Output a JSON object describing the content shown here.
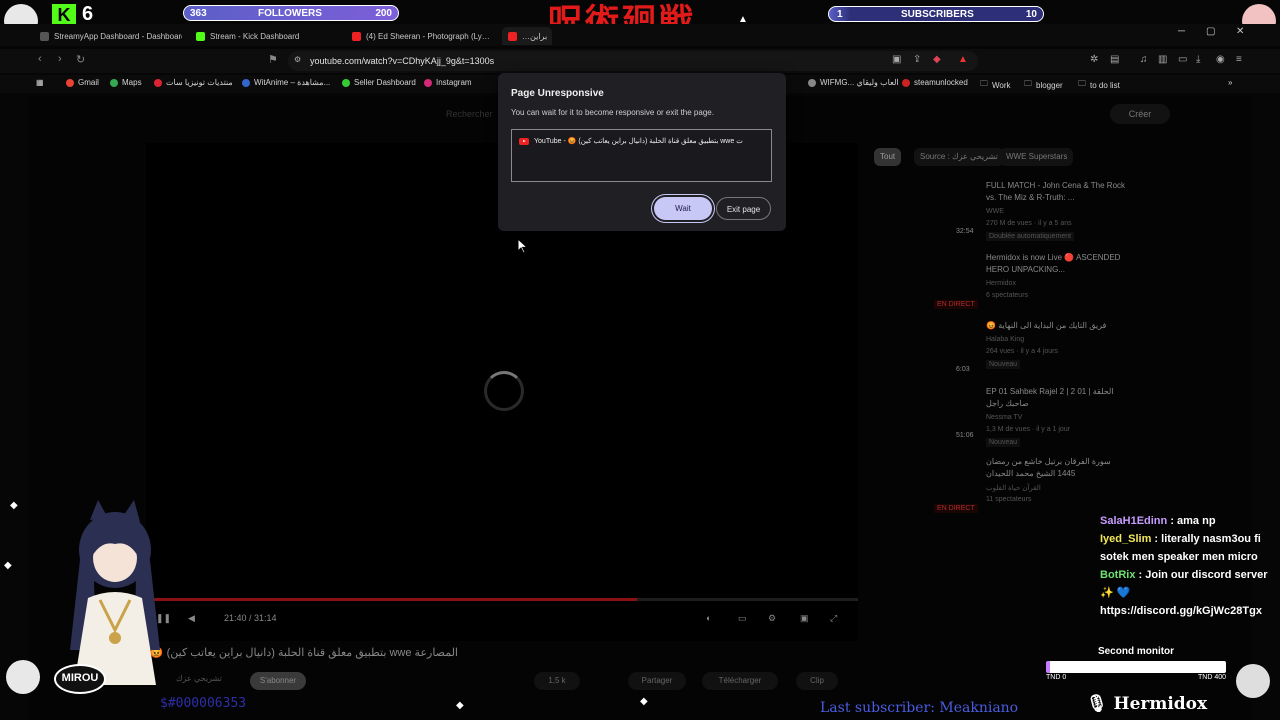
{
  "overlay": {
    "kick_count": "6",
    "kick_logo": "K",
    "followers": {
      "current": "363",
      "label": "FOLLOWERS",
      "goal": "200",
      "progress": 1.0
    },
    "subscribers": {
      "current": "1",
      "label": "SUBSCRIBERS",
      "goal": "10",
      "progress": 0.1
    },
    "jp_title": "呪術廻戦",
    "chat": [
      {
        "name": "SalaH1Edinn",
        "text": ": ama np",
        "color": "purple"
      },
      {
        "name": "Iyed_Slim",
        "text": ": literally nasm3ou fi sotek men speaker men micro",
        "color": "yellow"
      },
      {
        "name": "BotRix",
        "text": ": Join our discord server ✨ 💙 https://discord.gg/kGjWc28Tgx",
        "color": "green"
      }
    ],
    "second_monitor": {
      "label": "Second monitor",
      "min": "TND 0",
      "max": "TND 400",
      "progress": 0.02
    },
    "brand": "🎙 Hermidox",
    "last_subscriber": "Last subscriber: Meakniano",
    "ticker": "$#000006353",
    "mirou_badge": "MIROU"
  },
  "browser": {
    "tabs": [
      {
        "label": "StreamyApp Dashboard - Dashboard",
        "color": "#555"
      },
      {
        "label": "Stream - Kick Dashboard",
        "color": "#53fc18"
      },
      {
        "label": "(4) Ed Sheeran - Photograph (Ly…",
        "color": "#e22"
      },
      {
        "label": "…براين",
        "color": "#e22"
      }
    ],
    "url": "youtube.com/watch?v=CDhyKAjj_9g&t=1300s",
    "bookmarks": [
      {
        "label": "Gmail",
        "color": "#ea4335"
      },
      {
        "label": "Maps",
        "color": "#34a853"
      },
      {
        "label": "منتديات تونيزيا سات",
        "color": "#d23"
      },
      {
        "label": "WitAnime – مشاهدة...",
        "color": "#36c"
      },
      {
        "label": "Seller Dashboard",
        "color": "#3c3"
      },
      {
        "label": "Instagram",
        "color": "#d62976"
      },
      {
        "label": "WIFMG... العاب وليقاي",
        "color": "#888"
      },
      {
        "label": "steamunlocked",
        "color": "#c22"
      },
      {
        "label": "Work",
        "color": "#999"
      },
      {
        "label": "blogger",
        "color": "#999"
      },
      {
        "label": "to do list",
        "color": "#999"
      }
    ]
  },
  "youtube": {
    "search_placeholder": "Rechercher",
    "create_label": "Créer",
    "time": "21:40 / 31:14",
    "progress": 0.69,
    "video_title": "المصارعة wwe بتطبيق معلق قناة الحلبة (دانيال براين يعاتب كين) 😡",
    "channel": "تشريحي عزك",
    "subscribe": "S'abonner",
    "actions": [
      "1,5 k",
      "Partager",
      "Télécharger",
      "Clip"
    ],
    "chips": [
      "Tout",
      "Source : تشريحي عزك",
      "WWE Superstars"
    ],
    "recommendations": [
      {
        "title": "FULL MATCH - John Cena & The Rock vs. The Miz & R-Truth: ...",
        "meta1": "WWE",
        "meta2": "270 M de vues · il y a 5 ans",
        "duration": "32:54",
        "badge": "Doublée automatiquement"
      },
      {
        "title": "Hermidox is now Live 🔴 ASCENDED HERO UNPACKING...",
        "meta1": "Hermidox",
        "meta2": "6 spectateurs",
        "duration": "EN DIRECT",
        "badge": ""
      },
      {
        "title": "😡 فريق التايك من البداية الى النهاية",
        "meta1": "Halaba King",
        "meta2": "264 vues · il y a 4 jours",
        "duration": "6:03",
        "badge": "Nouveau"
      },
      {
        "title": "EP 01 Sahbek Rajel 2 | 2 01 الحلقة | صاحبك راجل",
        "meta1": "Nessma TV",
        "meta2": "1,3 M de vues · il y a 1 jour",
        "duration": "51:06",
        "badge": "Nouveau"
      },
      {
        "title": "سورة الفرقان برتيل خاشع من رمضان 1445 الشيخ محمد اللحيدان",
        "meta1": "القرآن حياة القلوب",
        "meta2": "11 spectateurs",
        "duration": "EN DIRECT",
        "badge": ""
      }
    ]
  },
  "dialog": {
    "title": "Page Unresponsive",
    "description": "You can wait for it to become responsive or exit the page.",
    "page_item": "YouTube - 😡 بتطبيق معلق قناة الحلبة (دانيال براين يعاتب كين) wwe ت",
    "wait_label": "Wait",
    "exit_label": "Exit page"
  }
}
